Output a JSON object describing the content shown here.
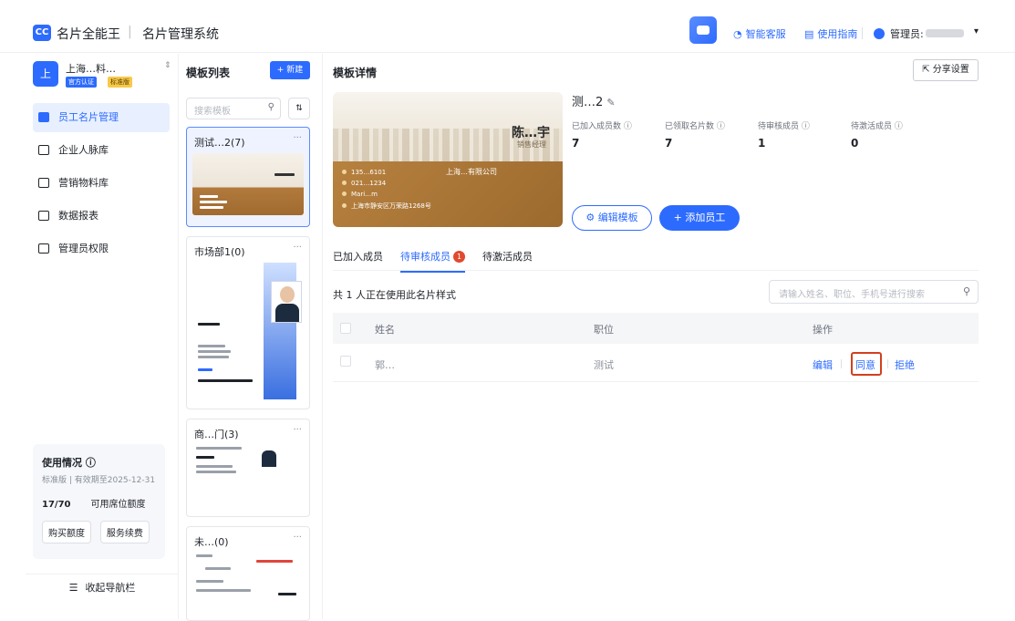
{
  "header": {
    "logo_text": "CC",
    "brand": "名片全能王",
    "separator": "|",
    "system_name": "名片管理系统",
    "links": [
      {
        "label": "智能客服",
        "icon": "headset-icon"
      },
      {
        "label": "使用指南",
        "icon": "document-icon"
      }
    ],
    "admin_label": "管理员:"
  },
  "sidebar": {
    "org_avatar": "上",
    "org_name": "上海…料…",
    "badges": [
      "官方认证",
      "标准版"
    ],
    "items": [
      {
        "label": "员工名片管理",
        "active": true
      },
      {
        "label": "企业人脉库",
        "active": false
      },
      {
        "label": "营销物料库",
        "active": false
      },
      {
        "label": "数据报表",
        "active": false
      },
      {
        "label": "管理员权限",
        "active": false
      }
    ],
    "usage": {
      "title": "使用情况",
      "subtitle": "标准版 | 有效期至2025-12-31",
      "count": "17/70",
      "count_label": "可用席位额度",
      "buy": "购买额度",
      "renew": "服务续费"
    },
    "collapse": "收起导航栏"
  },
  "templates": {
    "heading": "模板列表",
    "new_button": "+ 新建",
    "search_placeholder": "搜索模板",
    "sort_icon": "⇅",
    "cards": [
      {
        "title": "测试…2(7)",
        "selected": true
      },
      {
        "title": "市场部1(0)",
        "selected": false
      },
      {
        "title": "商…门(3)",
        "selected": false
      },
      {
        "title": "未…(0)",
        "selected": false
      }
    ],
    "more": "···"
  },
  "detail": {
    "title": "模板详情",
    "share": "分享设置",
    "card": {
      "name": "陈…宇",
      "role": "销售经理",
      "company": "上海…有限公司",
      "lines": [
        "135…6101",
        "021…1234",
        "Mari…m",
        "上海市静安区万荣路1268号"
      ]
    },
    "template_name": "测…2",
    "stats": [
      {
        "label": "已加入成员数",
        "value": "7"
      },
      {
        "label": "已领取名片数",
        "value": "7"
      },
      {
        "label": "待审核成员",
        "value": "1"
      },
      {
        "label": "待激活成员",
        "value": "0"
      }
    ],
    "edit_button": "编辑模板",
    "add_button": "+ 添加员工",
    "tabs": [
      {
        "label": "已加入成员",
        "active": false
      },
      {
        "label": "待审核成员",
        "active": true,
        "badge": "1"
      },
      {
        "label": "待激活成员",
        "active": false
      }
    ],
    "count_text": "共 1 人正在使用此名片样式",
    "search_placeholder": "请输入姓名、职位、手机号进行搜索",
    "columns": [
      "姓名",
      "职位",
      "操作"
    ],
    "rows": [
      {
        "name": "郭…",
        "position": "测试",
        "actions": [
          "编辑",
          "同意",
          "拒绝"
        ]
      }
    ]
  }
}
